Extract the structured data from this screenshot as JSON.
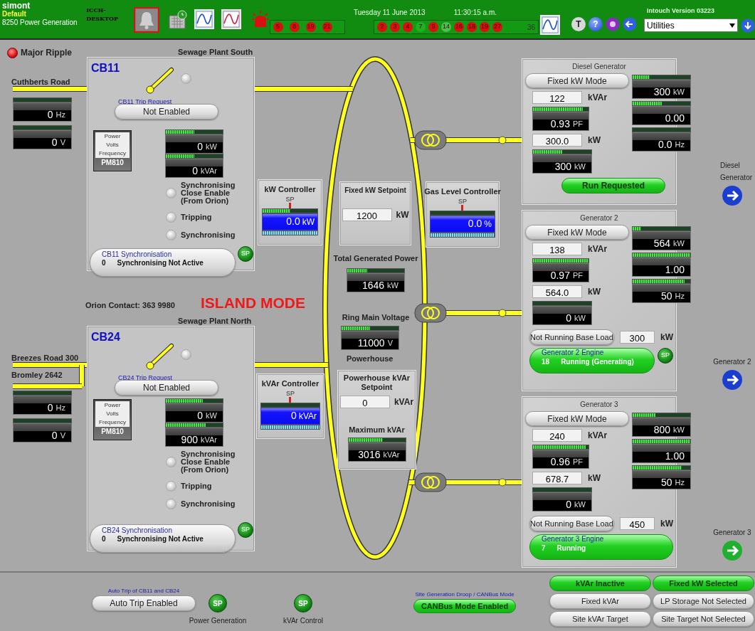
{
  "header": {
    "user": "simont",
    "group": "Default",
    "plant": "8250 Power Generation",
    "node": "ICCH-DESKTOP",
    "date": "Tuesday 11 June 2013",
    "time": "11:30:15 a.m.",
    "alarms_a": [
      {
        "text": "5",
        "color": "#d81010"
      },
      {
        "text": "8",
        "color": "#d81010"
      },
      {
        "text": "19",
        "color": "#d81010"
      },
      {
        "text": "21",
        "color": "#d81010"
      }
    ],
    "alarms_b": [
      {
        "text": "2",
        "color": "#d81010"
      },
      {
        "text": "3",
        "color": "#d81010"
      },
      {
        "text": "4",
        "color": "#d81010"
      },
      {
        "text": "7",
        "color": "#20b020"
      },
      {
        "text": "9",
        "color": "#d81010"
      },
      {
        "text": "14",
        "color": "#4cc04c"
      },
      {
        "text": "16",
        "color": "#d81010"
      },
      {
        "text": "18",
        "color": "#d81010"
      },
      {
        "text": "19",
        "color": "#d81010"
      },
      {
        "text": "27",
        "color": "#d81010"
      }
    ],
    "alarm_total": "36",
    "tool_buttons": [
      "T",
      "?"
    ],
    "version": "Intouch Version 03223",
    "menu": "Utilities"
  },
  "ripple": {
    "label": "Major Ripple",
    "on": true
  },
  "feeders": [
    {
      "breaker": "CB11",
      "plant": "Sewage Plant South",
      "roads": [
        "Cuthberts Road"
      ],
      "closed": false,
      "hz": {
        "value": "0",
        "unit": "Hz",
        "level": 0
      },
      "volts": {
        "value": "0",
        "unit": "V",
        "level": 0
      },
      "trip_label": "CB11 Trip Request",
      "trip": "Not Enabled",
      "pm": {
        "lines": [
          "Power",
          "Volts",
          "Frequency"
        ],
        "model": "PM810"
      },
      "kw": {
        "value": "0",
        "unit": "kW",
        "level": 0.5
      },
      "kvar": {
        "value": "0",
        "unit": "kVAr",
        "level": 0.5
      },
      "indicators": [
        {
          "label": "Synchronising Close Enable (From Orion)",
          "on": false
        },
        {
          "label": "Tripping",
          "on": false
        },
        {
          "label": "Synchronising",
          "on": false
        }
      ],
      "sync_label": "CB11 Synchronisation",
      "sync_code": "0",
      "sync_status": "Synchronising Not Active",
      "sp": "SP"
    },
    {
      "breaker": "CB24",
      "plant": "Sewage Plant North",
      "roads": [
        "Breezes Road 300",
        "Bromley 2642"
      ],
      "closed": false,
      "hz": {
        "value": "0",
        "unit": "Hz",
        "level": 0
      },
      "volts": {
        "value": "0",
        "unit": "V",
        "level": 0
      },
      "trip_label": "CB24 Trip Request",
      "trip": "Not Enabled",
      "pm": {
        "lines": [
          "Power",
          "Volts",
          "Frequency"
        ],
        "model": "PM810"
      },
      "kw": {
        "value": "0",
        "unit": "kW",
        "level": 0.65
      },
      "kvar": {
        "value": "900",
        "unit": "kVAr",
        "level": 0.7
      },
      "indicators": [
        {
          "label": "Synchronising Close Enable (From Orion)",
          "on": false
        },
        {
          "label": "Tripping",
          "on": false
        },
        {
          "label": "Synchronising",
          "on": false
        }
      ],
      "sync_label": "CB24 Synchronisation",
      "sync_code": "0",
      "sync_status": "Synchronising Not Active",
      "sp": "SP"
    }
  ],
  "controllers": [
    {
      "title": "kW Controller",
      "sp": "SP",
      "value": "0.0",
      "unit": "kW",
      "level": 0.5
    },
    {
      "title": "kVAr Controller",
      "sp": "SP",
      "value": "0",
      "unit": "kVAr",
      "level": 0
    },
    {
      "title": "Gas Level Controller",
      "sp": "SP",
      "value": "0.0",
      "unit": "%",
      "level": 0
    }
  ],
  "orion_contact": "Orion Contact: 363 9980",
  "mode_banner": "ISLAND MODE",
  "center": {
    "setpoint_title": "Fixed kW Setpoint",
    "setpoint": "1200",
    "setpoint_unit": "kW",
    "total_title": "Total Generated Power",
    "total": {
      "value": "1646",
      "unit": "kW",
      "level": 0.35
    },
    "ring_title": "Ring Main Voltage",
    "ring": {
      "value": "11000",
      "unit": "V",
      "level": 0.5
    },
    "ring_caption": "Powerhouse",
    "kvar_sp_title": "Powerhouse kVAr Setpoint",
    "kvar_sp": "0",
    "kvar_sp_unit": "kVAr",
    "max_title": "Maximum kVAr",
    "max": {
      "value": "3016",
      "unit": "kVAr",
      "level": 0.6
    }
  },
  "generators": [
    {
      "kind": "diesel",
      "title": "Diesel Generator",
      "mode": "Fixed kW Mode",
      "kvar_sp": "122",
      "kvar_unit": "kVAr",
      "pf": {
        "value": "0.93",
        "unit": "PF",
        "level": 0.9
      },
      "kw_sp": "300.0",
      "kw_unit": "kW",
      "kw": {
        "value": "300",
        "unit": "kW",
        "level": 0.5
      },
      "right": [
        {
          "value": "300",
          "unit": "kW",
          "level": 0.3
        },
        {
          "value": "0.00",
          "level": 0.5
        },
        {
          "value": "0.0",
          "unit": "Hz",
          "level": 0
        }
      ],
      "run": "Run Requested",
      "nav": "Diesel Generator",
      "color": "#1a3fd0"
    },
    {
      "kind": "generator",
      "title": "Generator 2",
      "mode": "Fixed kW Mode",
      "kvar_sp": "138",
      "kvar_unit": "kVAr",
      "pf": {
        "value": "0.97",
        "unit": "PF",
        "level": 1
      },
      "kw_sp": "564.0",
      "kw_unit": "kW",
      "kw": {
        "value": "0",
        "unit": "kW",
        "level": 0
      },
      "right": [
        {
          "value": "564",
          "unit": "kW",
          "level": 0.15
        },
        {
          "value": "1.00",
          "level": 1
        },
        {
          "value": "50",
          "unit": "Hz",
          "level": 0.9
        }
      ],
      "base_load": "Not Running Base Load",
      "base_value": "300",
      "base_unit": "kW",
      "engine_label": "Generator 2 Engine",
      "engine_code": "18",
      "engine_status": "Running (Generating)",
      "sp": "SP",
      "nav": "Generator 2",
      "color": "#1a3fd0"
    },
    {
      "kind": "generator",
      "title": "Generator 3",
      "mode": "Fixed kW Mode",
      "kvar_sp": "240",
      "kvar_unit": "kVAr",
      "pf": {
        "value": "0.96",
        "unit": "PF",
        "level": 0.95
      },
      "kw_sp": "678.7",
      "kw_unit": "kW",
      "kw": {
        "value": "0",
        "unit": "kW",
        "level": 0
      },
      "right": [
        {
          "value": "800",
          "unit": "kW",
          "level": 0.4
        },
        {
          "value": "1.00",
          "level": 1
        },
        {
          "value": "50",
          "unit": "Hz",
          "level": 0.85
        }
      ],
      "base_load": "Not Running Base Load",
      "base_value": "450",
      "base_unit": "kW",
      "engine_label": "Generator 3 Engine",
      "engine_code": "7",
      "engine_status": "Running",
      "nav": "Generator 3",
      "color": "#20b030"
    }
  ],
  "footer": {
    "auto_trip_label": "Auto Trip of CB11 and CB24",
    "auto_trip": "Auto Trip Enabled",
    "sp_buttons": [
      {
        "text": "SP",
        "caption": "Power Generation"
      },
      {
        "text": "SP",
        "caption": "kVAr Control"
      }
    ],
    "droop_label": "Site Generation Droop / CANBus Mode",
    "droop": "CANBus Mode Enabled",
    "modes": [
      {
        "text": "kVAr Inactive",
        "active": true
      },
      {
        "text": "Fixed kW Selected",
        "active": true
      },
      {
        "text": "Fixed kVAr",
        "active": false
      },
      {
        "text": "LP Storage Not Selected",
        "active": false
      },
      {
        "text": "Site kVAr Target",
        "active": false
      },
      {
        "text": "Site Target Not Selected",
        "active": false
      }
    ]
  }
}
